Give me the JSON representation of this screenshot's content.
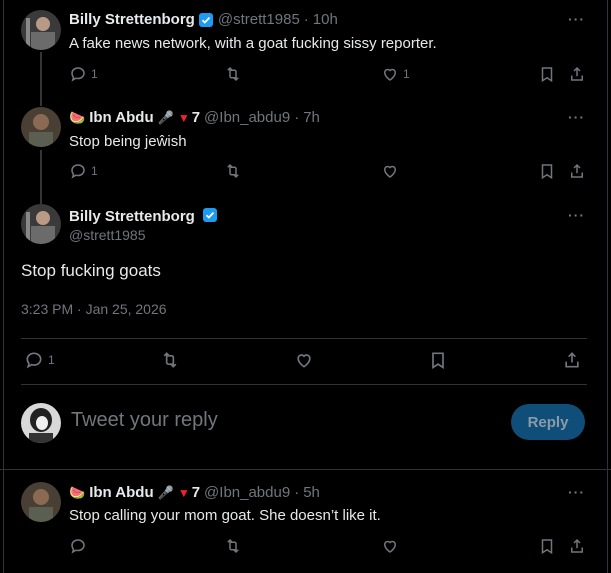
{
  "colors": {
    "background": "#000000",
    "text": "#e7e9ea",
    "muted": "#71767b",
    "accent": "#1d9bf0",
    "reply_button_bg": "#0f4e78"
  },
  "tweets": [
    {
      "name": "Billy Strettenborg",
      "handle": "@strett1985",
      "time": "10h",
      "text": "A fake news network, with a goat fucking sissy reporter.",
      "reply_count": "1",
      "retweet_count": "",
      "like_count": "1",
      "verified": true
    },
    {
      "name": "Ibn Abdu",
      "name_suffix": "7",
      "handle": "@Ibn_abdu9",
      "time": "7h",
      "text": "Stop being jeŵish",
      "reply_count": "1",
      "retweet_count": "",
      "like_count": ""
    }
  ],
  "main_tweet": {
    "name": "Billy Strettenborg",
    "handle": "@strett1985",
    "text": "Stop fucking goats",
    "datetime": "3:23 PM · Jan 25, 2026",
    "reply_count": "1"
  },
  "reply_composer": {
    "placeholder": "Tweet your reply",
    "button_label": "Reply"
  },
  "last_reply": {
    "name": "Ibn Abdu",
    "name_suffix": "7",
    "handle": "@Ibn_abdu9",
    "time": "5h",
    "text": "Stop calling your mom goat. She doesn’t like it."
  },
  "icons": [
    "reply-icon",
    "retweet-icon",
    "like-icon",
    "bookmark-icon",
    "share-icon",
    "more-icon",
    "verified-icon"
  ],
  "more_label": "···",
  "dot": "·"
}
